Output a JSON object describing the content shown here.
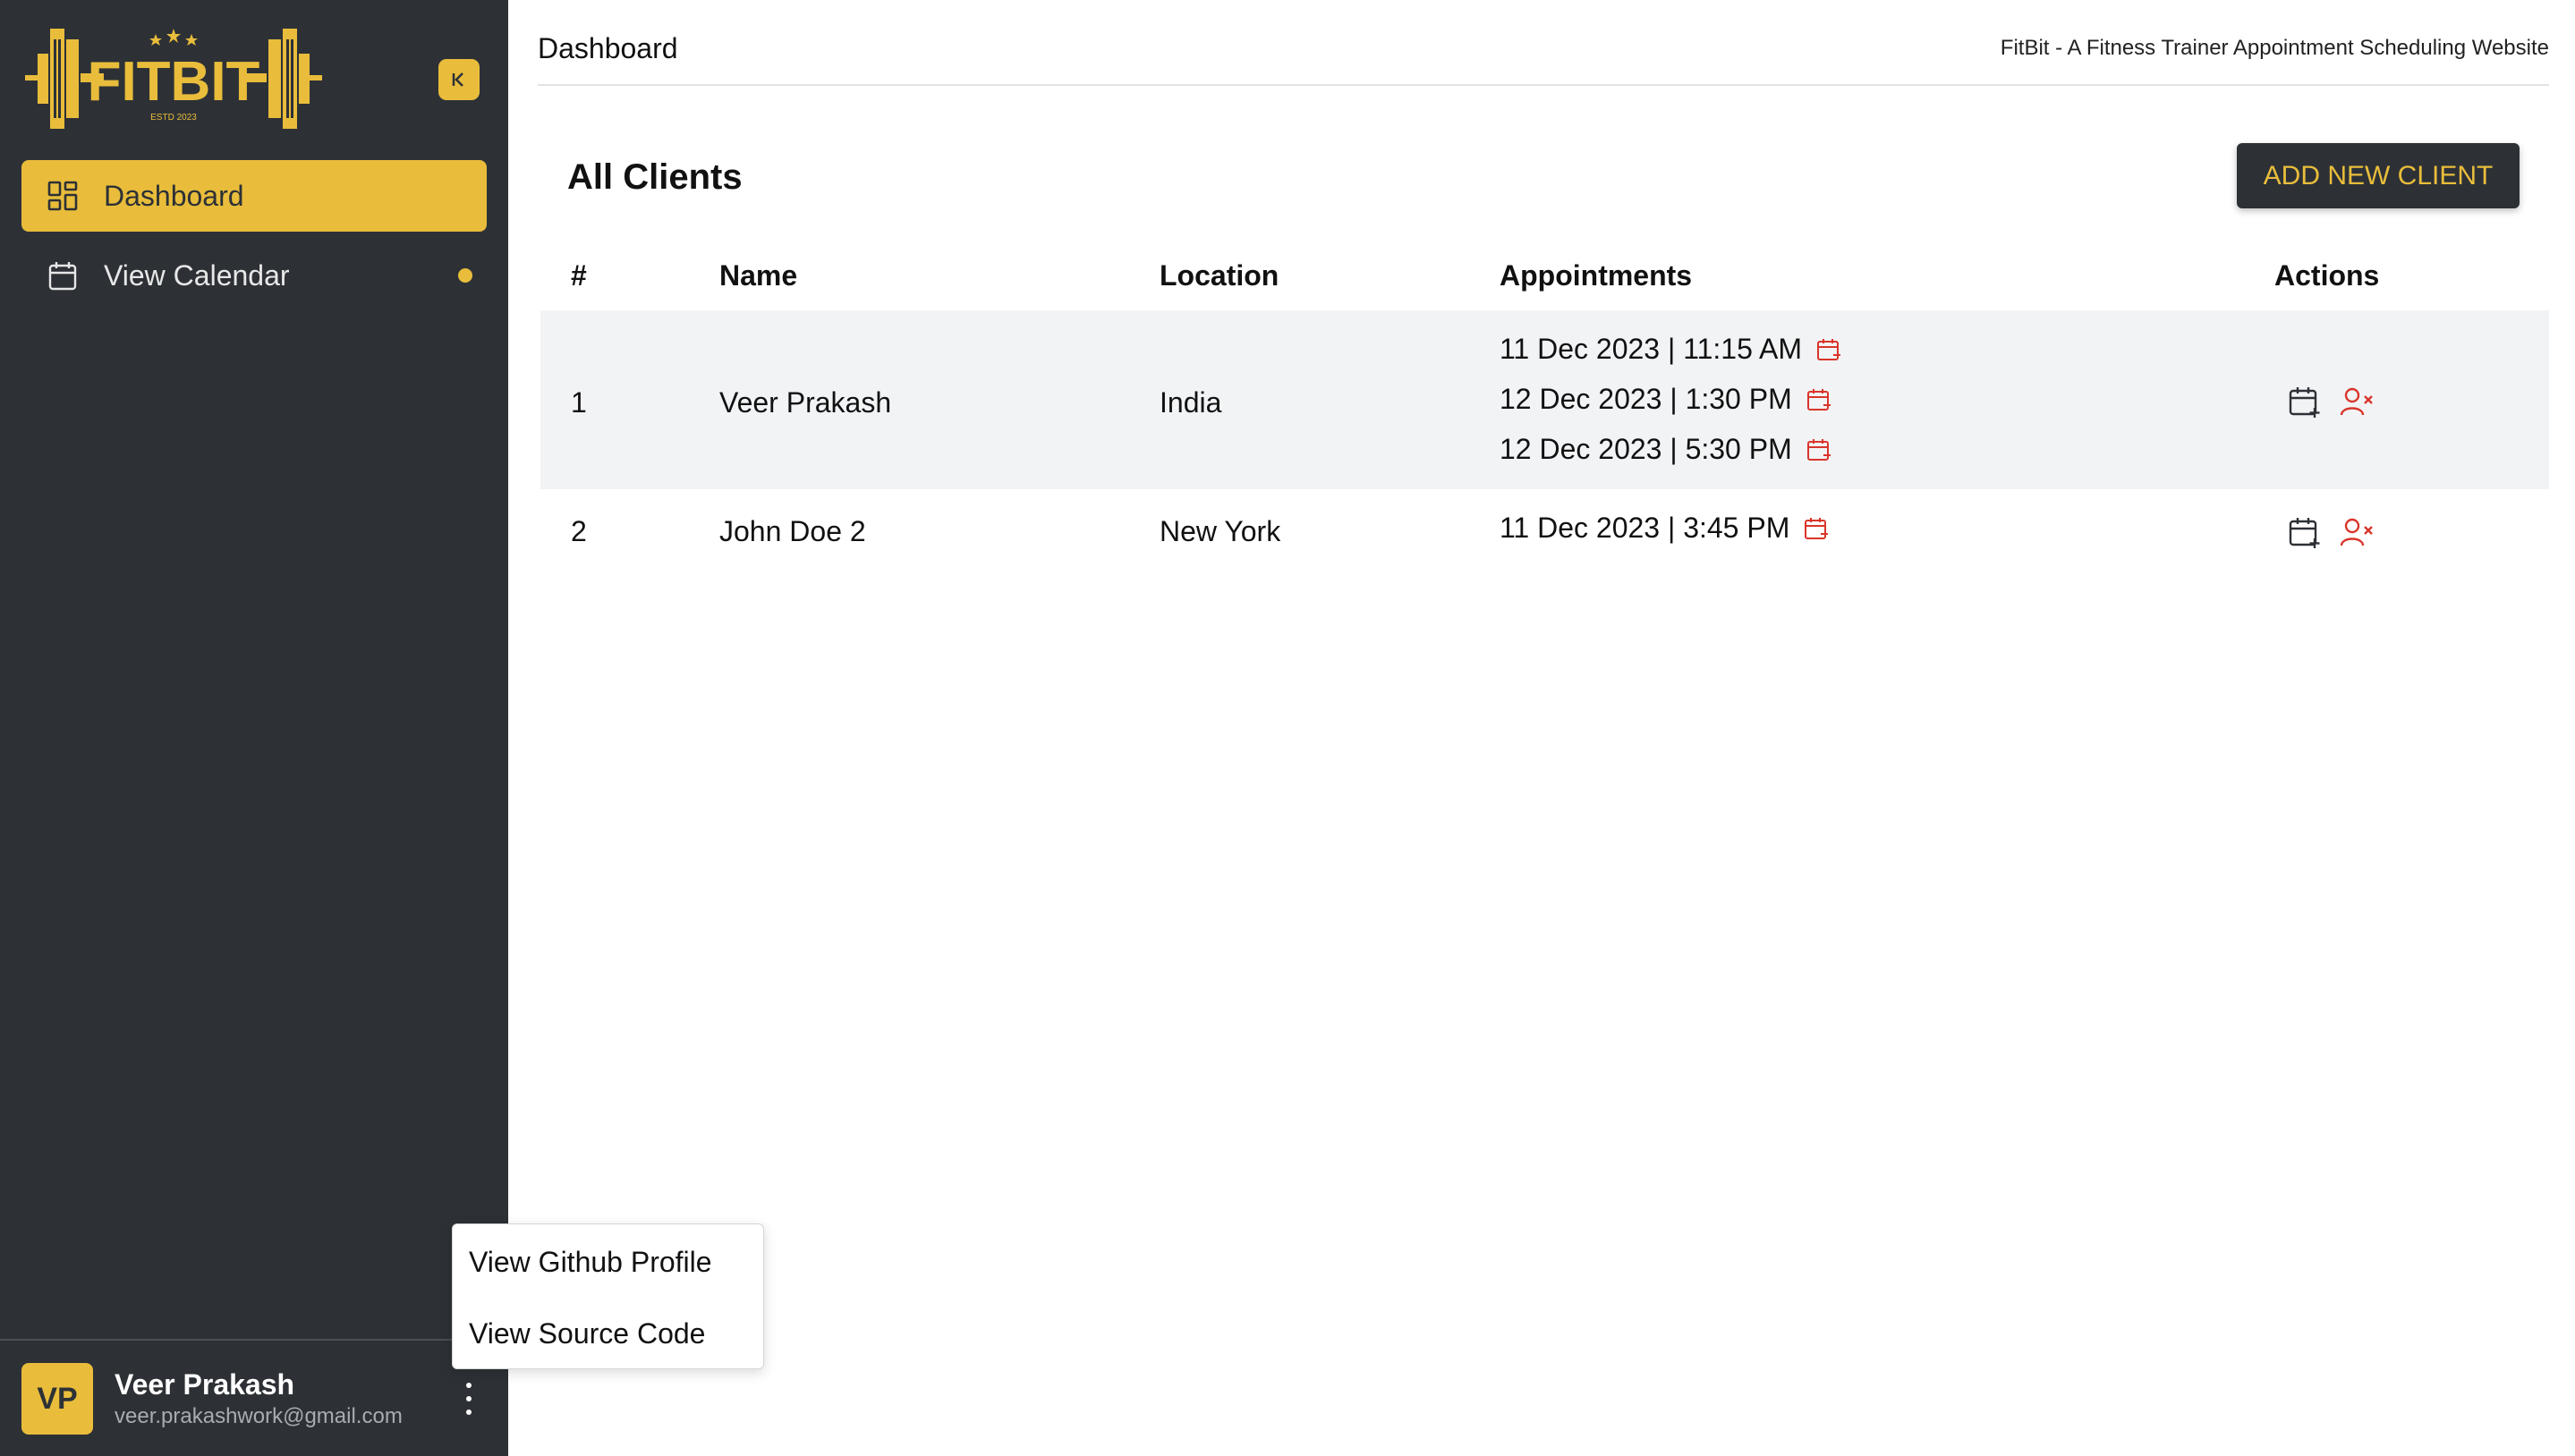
{
  "brand": {
    "logo_text": "FITBIT",
    "logo_subtext": "ESTD 2023",
    "accent_color": "#e9bd3b",
    "sidebar_color": "#2d3136",
    "danger_color": "#d9352b"
  },
  "sidebar": {
    "collapse_icon": "collapse-left-icon",
    "items": [
      {
        "label": "Dashboard",
        "icon": "dashboard-grid-icon",
        "active": true
      },
      {
        "label": "View Calendar",
        "icon": "calendar-icon",
        "active": false
      }
    ],
    "user": {
      "initials": "VP",
      "name": "Veer Prakash",
      "email": "veer.prakashwork@gmail.com"
    }
  },
  "popup_menu": {
    "items": [
      "View Github Profile",
      "View Source Code"
    ]
  },
  "header": {
    "title": "Dashboard",
    "site_title": "FitBit - A Fitness Trainer Appointment Scheduling Website"
  },
  "main": {
    "section_title": "All Clients",
    "add_button_label": "ADD NEW CLIENT",
    "table": {
      "headers": [
        "#",
        "Name",
        "Location",
        "Appointments",
        "Actions"
      ],
      "rows": [
        {
          "index": "1",
          "name": "Veer Prakash",
          "location": "India",
          "appointments": [
            "11 Dec 2023 | 11:15 AM",
            "12 Dec 2023 | 1:30 PM",
            "12 Dec 2023 | 5:30 PM"
          ]
        },
        {
          "index": "2",
          "name": "John Doe 2",
          "location": "New York",
          "appointments": [
            "11 Dec 2023 | 3:45 PM"
          ]
        }
      ]
    }
  }
}
